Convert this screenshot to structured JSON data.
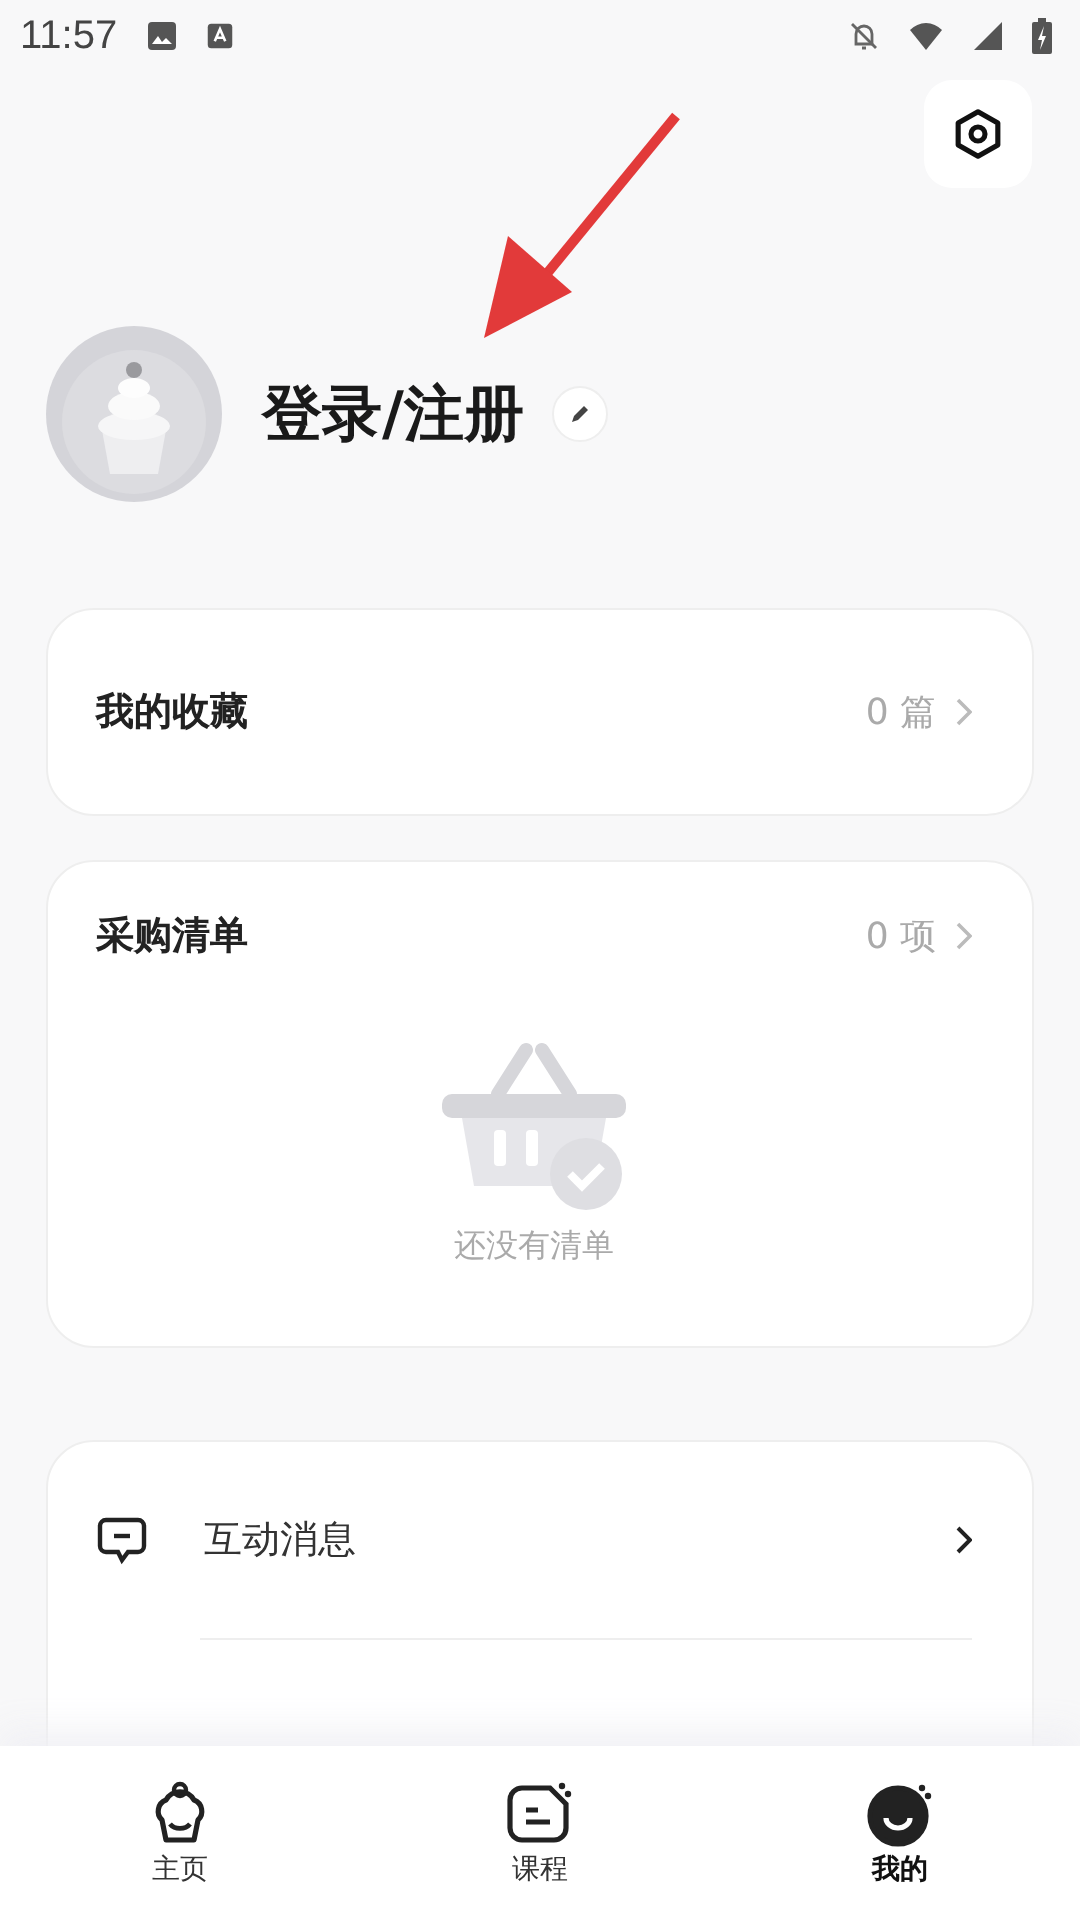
{
  "status_bar": {
    "time": "11:57"
  },
  "profile": {
    "name": "登录/注册"
  },
  "favorites": {
    "title": "我的收藏",
    "count": "0 篇"
  },
  "shopping_list": {
    "title": "采购清单",
    "count": "0 项",
    "empty_text": "还没有清单"
  },
  "menu": [
    {
      "kind": "message",
      "label": "互动消息"
    }
  ],
  "tabs": [
    {
      "kind": "home",
      "label": "主页",
      "selected": false
    },
    {
      "kind": "course",
      "label": "课程",
      "selected": false
    },
    {
      "kind": "me",
      "label": "我的",
      "selected": true
    }
  ]
}
